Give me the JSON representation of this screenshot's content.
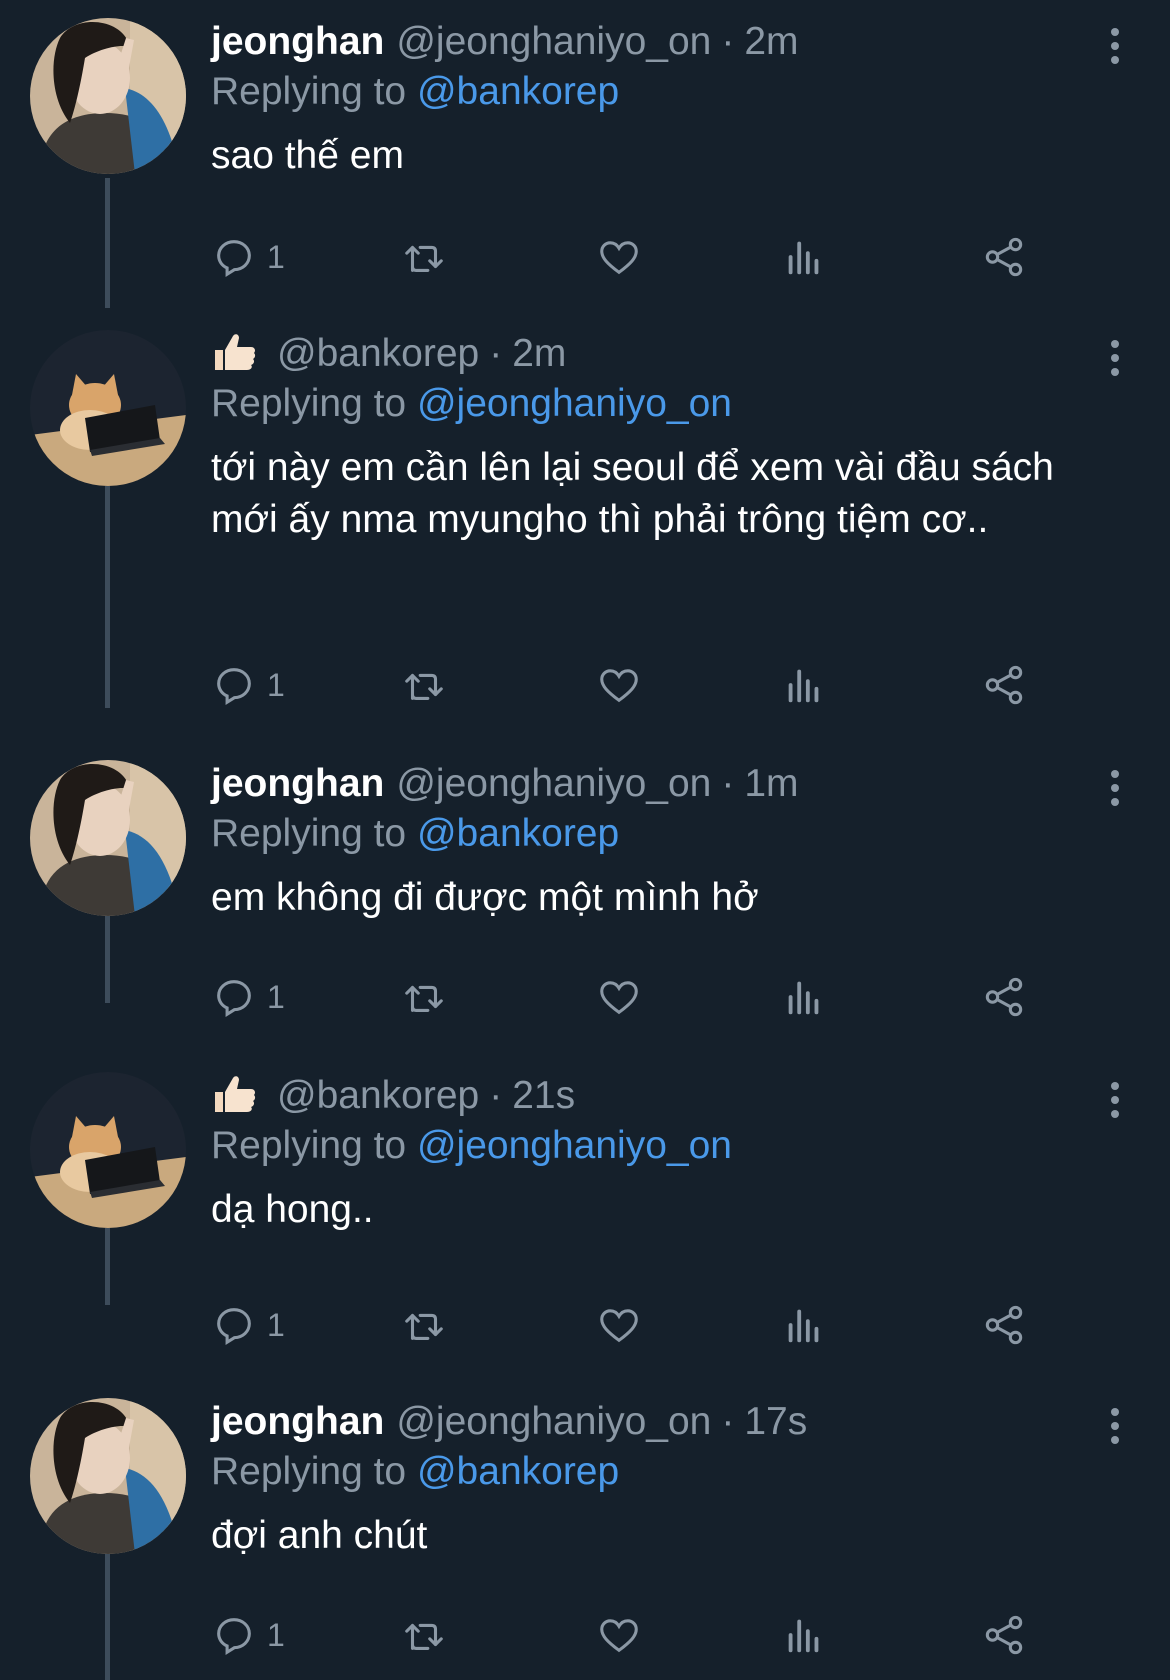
{
  "tweets": [
    {
      "name": "jeonghan",
      "handle": "@jeonghaniyo_on",
      "time": "2m",
      "reply_prefix": "Replying to",
      "reply_to": "@bankorep",
      "text": "sao thế em",
      "reply_count": "1",
      "avatar": "person-avatar"
    },
    {
      "name": "",
      "handle": "@bankorep",
      "time": "2m",
      "reply_prefix": "Replying to",
      "reply_to": "@jeonghaniyo_on",
      "text": "tới này em cần lên lại seoul để xem vài đầu sách mới ấy nma myungho thì phải trông tiệm cơ..",
      "reply_count": "1",
      "avatar": "cat-avatar",
      "name_icon": "thumbs-up-emoji"
    },
    {
      "name": "jeonghan",
      "handle": "@jeonghaniyo_on",
      "time": "1m",
      "reply_prefix": "Replying to",
      "reply_to": "@bankorep",
      "text": "em không đi được một mình hở",
      "reply_count": "1",
      "avatar": "person-avatar"
    },
    {
      "name": "",
      "handle": "@bankorep",
      "time": "21s",
      "reply_prefix": "Replying to",
      "reply_to": "@jeonghaniyo_on",
      "text": "dạ hong..",
      "reply_count": "1",
      "avatar": "cat-avatar",
      "name_icon": "thumbs-up-emoji"
    },
    {
      "name": "jeonghan",
      "handle": "@jeonghaniyo_on",
      "time": "17s",
      "reply_prefix": "Replying to",
      "reply_to": "@bankorep",
      "text": "đợi anh chút",
      "reply_count": "1",
      "avatar": "person-avatar"
    }
  ],
  "separator": "·",
  "icons": [
    "reply-icon",
    "retweet-icon",
    "like-icon",
    "views-icon",
    "share-icon",
    "more-icon"
  ],
  "colors": {
    "background": "#15202b",
    "name": "#ffffff",
    "muted": "#8b98a5",
    "link": "#4a99e9",
    "thread_line": "#3d4c5b"
  }
}
